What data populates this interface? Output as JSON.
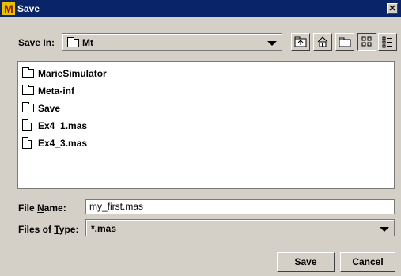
{
  "window": {
    "title": "Save",
    "app_icon_letter": "M",
    "close_glyph": "✕"
  },
  "save_in": {
    "label_pre": "Save ",
    "label_mnemonic": "I",
    "label_post": "n:",
    "folder_icon": "folder-icon",
    "value": "Mt"
  },
  "toolbar": {
    "buttons": [
      {
        "name": "up-one-level",
        "icon": "folder-up-icon"
      },
      {
        "name": "home",
        "icon": "home-icon"
      },
      {
        "name": "create-new-folder",
        "icon": "new-folder-icon"
      },
      {
        "name": "list-view",
        "icon": "list-view-icon",
        "active": true
      },
      {
        "name": "details-view",
        "icon": "details-view-icon"
      }
    ]
  },
  "files": [
    {
      "name": "MarieSimulator",
      "type": "folder",
      "icon": "folder-icon"
    },
    {
      "name": "Meta-inf",
      "type": "folder",
      "icon": "folder-icon"
    },
    {
      "name": "Save",
      "type": "folder",
      "icon": "folder-icon"
    },
    {
      "name": "Ex4_1.mas",
      "type": "file",
      "icon": "file-icon"
    },
    {
      "name": "Ex4_3.mas",
      "type": "file",
      "icon": "file-icon"
    }
  ],
  "file_name": {
    "label_pre": "File ",
    "label_mnemonic": "N",
    "label_post": "ame:",
    "value": "my_first.mas"
  },
  "files_of_type": {
    "label_pre": "Files of ",
    "label_mnemonic": "T",
    "label_post": "ype:",
    "value": "*.mas"
  },
  "buttons": {
    "save_label": "Save",
    "cancel_label": "Cancel"
  },
  "colors": {
    "title_bar": "#0a246a",
    "dialog_bg": "#d4d0c8",
    "list_bg": "#ffffff"
  }
}
